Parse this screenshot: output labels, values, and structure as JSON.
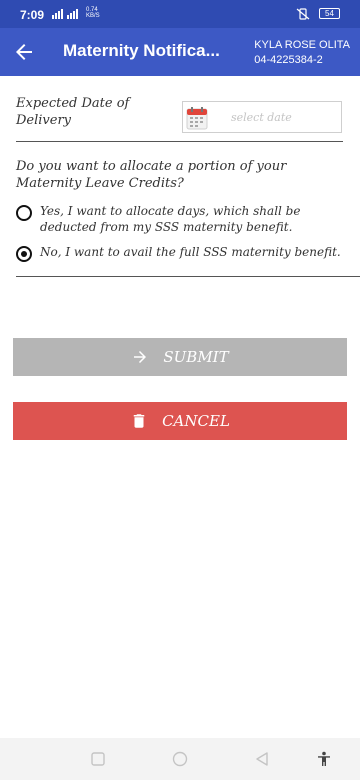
{
  "status_bar": {
    "time": "7:09",
    "network_speed_value": "0.74",
    "network_speed_unit": "KB/S",
    "battery": "54"
  },
  "app_bar": {
    "title": "Maternity Notifica...",
    "user_name": "KYLA ROSE OLITA",
    "user_id": "04-4225384-2"
  },
  "form": {
    "delivery_label": "Expected Date of Delivery",
    "date_placeholder": "select date",
    "question": "Do you want to allocate a portion of your Maternity Leave Credits?",
    "options": [
      {
        "label": "Yes, I want to allocate days, which shall be deducted from my SSS maternity benefit.",
        "selected": false
      },
      {
        "label": "No, I want to avail the full SSS maternity benefit.",
        "selected": true
      }
    ]
  },
  "buttons": {
    "submit_label": "SUBMIT",
    "cancel_label": "CANCEL"
  },
  "icons": {
    "back": "arrow-left-icon",
    "calendar": "calendar-icon",
    "submit": "arrow-right-icon",
    "cancel": "trash-icon",
    "nav_recents": "square-icon",
    "nav_home": "circle-icon",
    "nav_back": "triangle-icon",
    "nav_accessibility": "accessibility-icon"
  },
  "colors": {
    "status_bar": "#2f4bb2",
    "app_bar": "#3d59c5",
    "submit_bg": "#b5b5b5",
    "cancel_bg": "#dd5450"
  }
}
